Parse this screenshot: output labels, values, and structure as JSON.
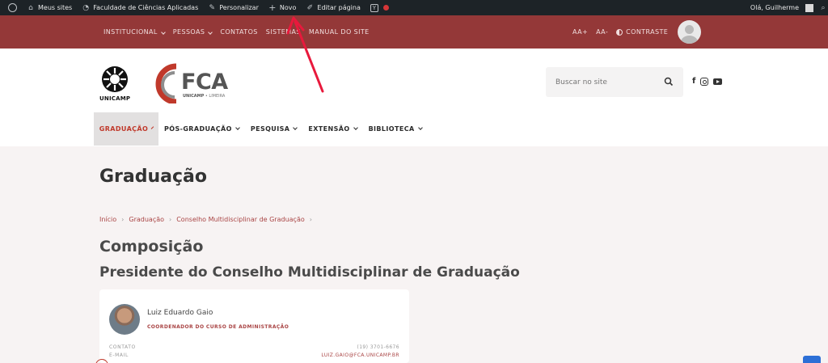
{
  "adminbar": {
    "my_sites": "Meus sites",
    "site_name": "Faculdade de Ciências Aplicadas",
    "customize": "Personalizar",
    "new": "Novo",
    "edit_page": "Editar página",
    "greeting": "Olá, Guilherme"
  },
  "topnav": {
    "items": [
      "INSTITUCIONAL",
      "PESSOAS",
      "CONTATOS",
      "SISTEMAS",
      "MANUAL DO SITE"
    ],
    "font_increase": "AA+",
    "font_decrease": "AA-",
    "contrast": "CONTRASTE"
  },
  "header": {
    "unicamp_label": "UNICAMP",
    "fca_text": "FCA",
    "fca_sub_bold": "UNICAMP",
    "fca_sub_rest": " • LIMEIRA",
    "search_placeholder": "Buscar no site"
  },
  "mainmenu": [
    "GRADUAÇÃO",
    "PÓS-GRADUAÇÃO",
    "PESQUISA",
    "EXTENSÃO",
    "BIBLIOTECA"
  ],
  "content": {
    "page_title": "Graduação",
    "breadcrumb": [
      "Início",
      "Graduação",
      "Conselho Multidisciplinar de Graduação"
    ],
    "h2": "Composição",
    "h3": "Presidente do Conselho Multidisciplinar de Graduação"
  },
  "card": {
    "name": "Luiz Eduardo Gaio",
    "role": "COORDENADOR DO CURSO DE ADMINISTRAÇÃO",
    "contact_label": "CONTATO",
    "contact_value": "(19) 3701-6676",
    "email_label": "E-MAIL",
    "email_value": "LUIZ.GAIO@FCA.UNICAMP.BR"
  },
  "colors": {
    "adminbar_bg": "#1d2327",
    "topnav_bg": "#943838",
    "accent": "#a94444",
    "page_bg": "#f7f3f3",
    "annotation_arrow": "#e8193c"
  },
  "icons": [
    "wordpress-icon",
    "my-sites-icon",
    "dashboard-icon",
    "brush-icon",
    "plus-icon",
    "pencil-icon",
    "yoast-icon",
    "status-dot-icon",
    "search-icon",
    "facebook-icon",
    "instagram-icon",
    "youtube-icon",
    "contrast-icon",
    "user-avatar-icon"
  ]
}
